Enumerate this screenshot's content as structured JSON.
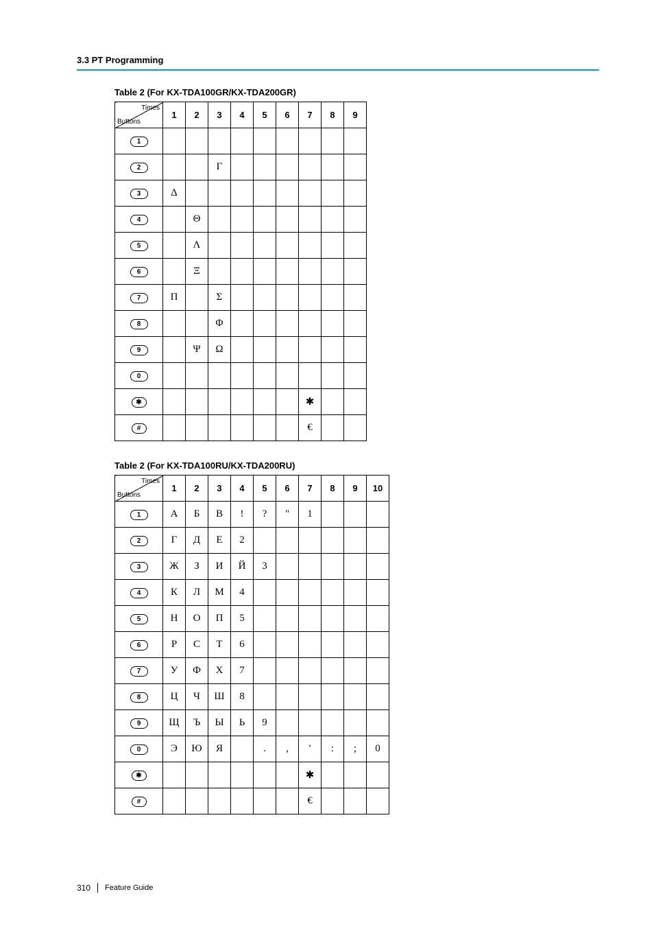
{
  "section_heading": "3.3 PT Programming",
  "footer": {
    "page_number": "310",
    "guide": "Feature Guide"
  },
  "table1": {
    "title": "Table 2 (For KX-TDA100GR/KX-TDA200GR)",
    "corner_top": "Times",
    "corner_bottom": "Buttons",
    "headers": [
      "1",
      "2",
      "3",
      "4",
      "5",
      "6",
      "7",
      "8",
      "9"
    ],
    "rows": [
      {
        "button": "1",
        "cells": [
          "",
          "",
          "",
          "",
          "",
          "",
          "",
          "",
          ""
        ]
      },
      {
        "button": "2",
        "cells": [
          "",
          "",
          "Γ",
          "",
          "",
          "",
          "",
          "",
          ""
        ]
      },
      {
        "button": "3",
        "cells": [
          "Δ",
          "",
          "",
          "",
          "",
          "",
          "",
          "",
          ""
        ]
      },
      {
        "button": "4",
        "cells": [
          "",
          "Θ",
          "",
          "",
          "",
          "",
          "",
          "",
          ""
        ]
      },
      {
        "button": "5",
        "cells": [
          "",
          "Λ",
          "",
          "",
          "",
          "",
          "",
          "",
          ""
        ]
      },
      {
        "button": "6",
        "cells": [
          "",
          "Ξ",
          "",
          "",
          "",
          "",
          "",
          "",
          ""
        ]
      },
      {
        "button": "7",
        "cells": [
          "Π",
          "",
          "Σ",
          "",
          "",
          "",
          "",
          "",
          ""
        ]
      },
      {
        "button": "8",
        "cells": [
          "",
          "",
          "Φ",
          "",
          "",
          "",
          "",
          "",
          ""
        ]
      },
      {
        "button": "9",
        "cells": [
          "",
          "Ψ",
          "Ω",
          "",
          "",
          "",
          "",
          "",
          ""
        ]
      },
      {
        "button": "0",
        "cells": [
          "",
          "",
          "",
          "",
          "",
          "",
          "",
          "",
          ""
        ]
      },
      {
        "button": "✱",
        "cells": [
          "",
          "",
          "",
          "",
          "",
          "",
          "✱",
          "",
          ""
        ]
      },
      {
        "button": "#",
        "cells": [
          "",
          "",
          "",
          "",
          "",
          "",
          "€",
          "",
          ""
        ]
      }
    ]
  },
  "table2": {
    "title": "Table 2 (For KX-TDA100RU/KX-TDA200RU)",
    "corner_top": "Times",
    "corner_bottom": "Buttons",
    "headers": [
      "1",
      "2",
      "3",
      "4",
      "5",
      "6",
      "7",
      "8",
      "9",
      "10"
    ],
    "rows": [
      {
        "button": "1",
        "cells": [
          "А",
          "Б",
          "В",
          "!",
          "?",
          "\"",
          "1",
          "",
          "",
          ""
        ]
      },
      {
        "button": "2",
        "cells": [
          "Г",
          "Д",
          "Е",
          "2",
          "",
          "",
          "",
          "",
          "",
          ""
        ]
      },
      {
        "button": "3",
        "cells": [
          "Ж",
          "З",
          "И",
          "Й",
          "3",
          "",
          "",
          "",
          "",
          ""
        ]
      },
      {
        "button": "4",
        "cells": [
          "К",
          "Л",
          "М",
          "4",
          "",
          "",
          "",
          "",
          "",
          ""
        ]
      },
      {
        "button": "5",
        "cells": [
          "Н",
          "О",
          "П",
          "5",
          "",
          "",
          "",
          "",
          "",
          ""
        ]
      },
      {
        "button": "6",
        "cells": [
          "Р",
          "С",
          "Т",
          "6",
          "",
          "",
          "",
          "",
          "",
          ""
        ]
      },
      {
        "button": "7",
        "cells": [
          "У",
          "Ф",
          "Х",
          "7",
          "",
          "",
          "",
          "",
          "",
          ""
        ]
      },
      {
        "button": "8",
        "cells": [
          "Ц",
          "Ч",
          "Ш",
          "8",
          "",
          "",
          "",
          "",
          "",
          ""
        ]
      },
      {
        "button": "9",
        "cells": [
          "Щ",
          "Ъ",
          "Ы",
          "Ь",
          "9",
          "",
          "",
          "",
          "",
          ""
        ]
      },
      {
        "button": "0",
        "cells": [
          "Э",
          "Ю",
          "Я",
          "",
          ".",
          ",",
          "'",
          ":",
          ";",
          "0"
        ]
      },
      {
        "button": "✱",
        "cells": [
          "",
          "",
          "",
          "",
          "",
          "",
          "✱",
          "",
          "",
          ""
        ]
      },
      {
        "button": "#",
        "cells": [
          "",
          "",
          "",
          "",
          "",
          "",
          "€",
          "",
          "",
          ""
        ]
      }
    ]
  }
}
